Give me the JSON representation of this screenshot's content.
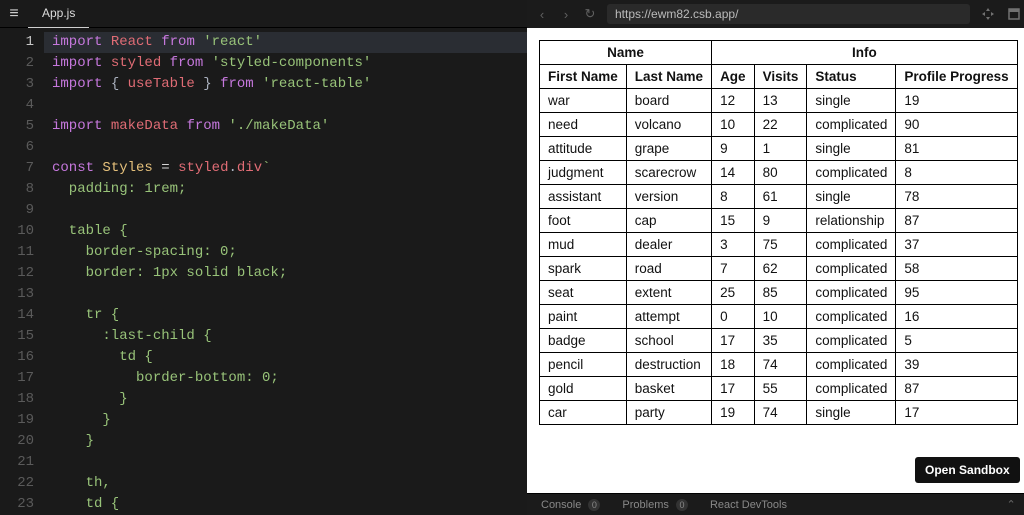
{
  "editor": {
    "filename": "App.js",
    "code_tokens": [
      [
        [
          "kw",
          "import "
        ],
        [
          "id",
          "React"
        ],
        [
          "plain",
          " "
        ],
        [
          "kw",
          "from"
        ],
        [
          "plain",
          " "
        ],
        [
          "str",
          "'react'"
        ]
      ],
      [
        [
          "kw",
          "import "
        ],
        [
          "id",
          "styled"
        ],
        [
          "plain",
          " "
        ],
        [
          "kw",
          "from"
        ],
        [
          "plain",
          " "
        ],
        [
          "str",
          "'styled-components'"
        ]
      ],
      [
        [
          "kw",
          "import "
        ],
        [
          "punc",
          "{ "
        ],
        [
          "id",
          "useTable"
        ],
        [
          "punc",
          " }"
        ],
        [
          "plain",
          " "
        ],
        [
          "kw",
          "from"
        ],
        [
          "plain",
          " "
        ],
        [
          "str",
          "'react-table'"
        ]
      ],
      [],
      [
        [
          "kw",
          "import "
        ],
        [
          "id",
          "makeData"
        ],
        [
          "plain",
          " "
        ],
        [
          "kw",
          "from"
        ],
        [
          "plain",
          " "
        ],
        [
          "str",
          "'./makeData'"
        ]
      ],
      [],
      [
        [
          "kw",
          "const "
        ],
        [
          "var",
          "Styles"
        ],
        [
          "plain",
          " = "
        ],
        [
          "id",
          "styled"
        ],
        [
          "punc",
          "."
        ],
        [
          "id",
          "div"
        ],
        [
          "str",
          "`"
        ]
      ],
      [
        [
          "str",
          "  padding: 1rem;"
        ]
      ],
      [],
      [
        [
          "str",
          "  table {"
        ]
      ],
      [
        [
          "str",
          "    border-spacing: 0;"
        ]
      ],
      [
        [
          "str",
          "    border: 1px solid black;"
        ]
      ],
      [],
      [
        [
          "str",
          "    tr {"
        ]
      ],
      [
        [
          "str",
          "      :last-child {"
        ]
      ],
      [
        [
          "str",
          "        td {"
        ]
      ],
      [
        [
          "str",
          "          border-bottom: 0;"
        ]
      ],
      [
        [
          "str",
          "        }"
        ]
      ],
      [
        [
          "str",
          "      }"
        ]
      ],
      [
        [
          "str",
          "    }"
        ]
      ],
      [],
      [
        [
          "str",
          "    th,"
        ]
      ],
      [
        [
          "str",
          "    td {"
        ]
      ]
    ],
    "highlight_line": 1
  },
  "preview": {
    "url": "https://ewm82.csb.app/",
    "open_sandbox_label": "Open Sandbox"
  },
  "table": {
    "group_headers": [
      "Name",
      "Info"
    ],
    "columns": [
      "First Name",
      "Last Name",
      "Age",
      "Visits",
      "Status",
      "Profile Progress"
    ],
    "rows": [
      [
        "war",
        "board",
        "12",
        "13",
        "single",
        "19"
      ],
      [
        "need",
        "volcano",
        "10",
        "22",
        "complicated",
        "90"
      ],
      [
        "attitude",
        "grape",
        "9",
        "1",
        "single",
        "81"
      ],
      [
        "judgment",
        "scarecrow",
        "14",
        "80",
        "complicated",
        "8"
      ],
      [
        "assistant",
        "version",
        "8",
        "61",
        "single",
        "78"
      ],
      [
        "foot",
        "cap",
        "15",
        "9",
        "relationship",
        "87"
      ],
      [
        "mud",
        "dealer",
        "3",
        "75",
        "complicated",
        "37"
      ],
      [
        "spark",
        "road",
        "7",
        "62",
        "complicated",
        "58"
      ],
      [
        "seat",
        "extent",
        "25",
        "85",
        "complicated",
        "95"
      ],
      [
        "paint",
        "attempt",
        "0",
        "10",
        "complicated",
        "16"
      ],
      [
        "badge",
        "school",
        "17",
        "35",
        "complicated",
        "5"
      ],
      [
        "pencil",
        "destruction",
        "18",
        "74",
        "complicated",
        "39"
      ],
      [
        "gold",
        "basket",
        "17",
        "55",
        "complicated",
        "87"
      ],
      [
        "car",
        "party",
        "19",
        "74",
        "single",
        "17"
      ]
    ]
  },
  "devtabs": {
    "console": "Console",
    "console_count": "0",
    "problems": "Problems",
    "problems_count": "0",
    "react": "React DevTools"
  }
}
